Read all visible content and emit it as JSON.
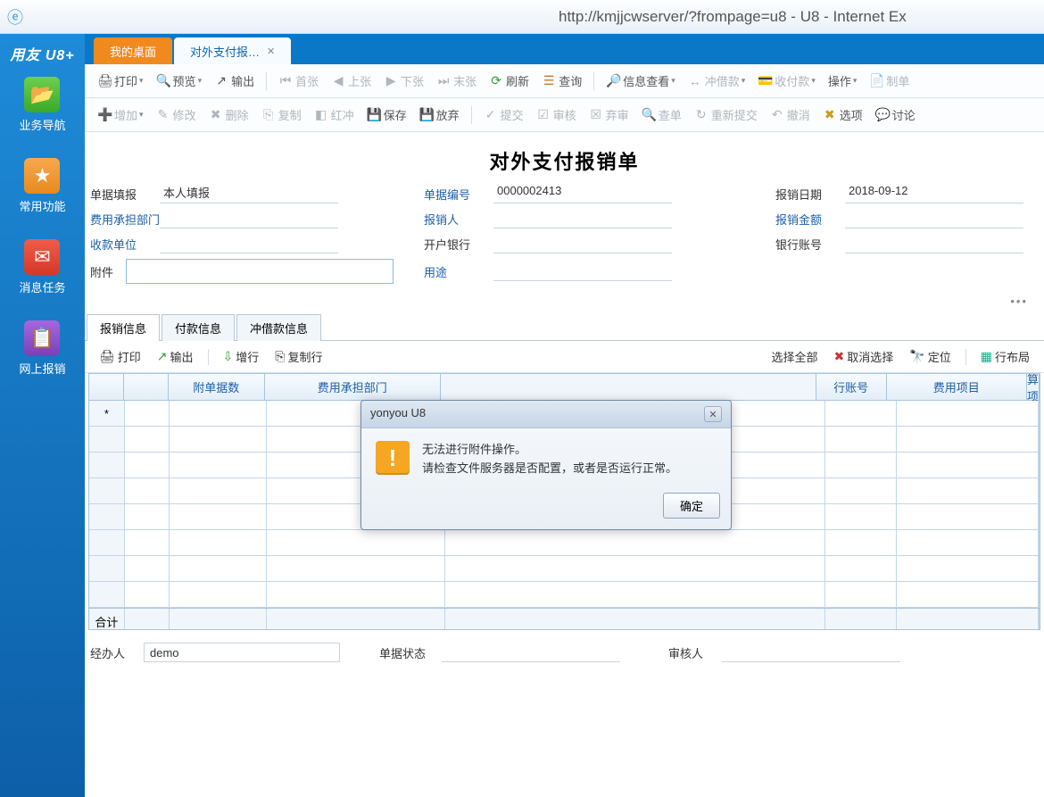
{
  "browser": {
    "title": "http://kmjjcwserver/?frompage=u8 - U8 - Internet Ex"
  },
  "brand": "用友 U8+",
  "sidebar": {
    "items": [
      {
        "label": "业务导航",
        "icon": "📂"
      },
      {
        "label": "常用功能",
        "icon": "★"
      },
      {
        "label": "消息任务",
        "icon": "✉"
      },
      {
        "label": "网上报销",
        "icon": "📋"
      }
    ]
  },
  "tabs": {
    "home": "我的桌面",
    "active": "对外支付报…"
  },
  "toolbar1": {
    "print": "打印",
    "preview": "预览",
    "export": "输出",
    "first": "首张",
    "prev": "上张",
    "next": "下张",
    "last": "末张",
    "refresh": "刷新",
    "query": "查询",
    "infoquery": "信息查看",
    "chongjiekuan": "冲借款",
    "shoufukuan": "收付款",
    "operate": "操作",
    "makebill": "制单"
  },
  "toolbar2": {
    "add": "增加",
    "edit": "修改",
    "delete": "删除",
    "copy": "复制",
    "hongchong": "红冲",
    "save": "保存",
    "abandon": "放弃",
    "submit": "提交",
    "audit": "审核",
    "unaudit": "弃审",
    "chadan": "查单",
    "resubmit": "重新提交",
    "cancelop": "撤消",
    "options": "选项",
    "discuss": "讨论"
  },
  "doc": {
    "title": "对外支付报销单",
    "fields": {
      "billfill_label": "单据填报",
      "billfill_value": "本人填报",
      "billno_label": "单据编号",
      "billno_value": "0000002413",
      "date_label": "报销日期",
      "date_value": "2018-09-12",
      "dept_label": "费用承担部门",
      "dept_value": "",
      "person_label": "报销人",
      "person_value": "",
      "amount_label": "报销金额",
      "amount_value": "",
      "payee_label": "收款单位",
      "payee_value": "",
      "bank_label": "开户银行",
      "bank_value": "",
      "account_label": "银行账号",
      "account_value": "",
      "attach_label": "附件",
      "attach_value": "",
      "usage_label": "用途",
      "usage_value": ""
    }
  },
  "subtabs": [
    "报销信息",
    "付款信息",
    "冲借款信息"
  ],
  "gridtoolbar": {
    "print": "打印",
    "export": "输出",
    "addrow": "增行",
    "copyrow": "复制行",
    "selectall": "选择全部",
    "unselect": "取消选择",
    "locate": "定位",
    "layout": "行布局"
  },
  "grid": {
    "columns": [
      "",
      "",
      "附单据数",
      "费用承担部门",
      "行账号",
      "费用项目",
      "预算项目"
    ],
    "widths": [
      40,
      50,
      110,
      200,
      170,
      190,
      160
    ],
    "row_marker": "*",
    "footer_label": "合计"
  },
  "bottom": {
    "handler_label": "经办人",
    "handler_value": "demo",
    "status_label": "单据状态",
    "status_value": "",
    "auditor_label": "审核人",
    "auditor_value": ""
  },
  "modal": {
    "title": "yonyou U8",
    "line1": "无法进行附件操作。",
    "line2": "请检查文件服务器是否配置，或者是否运行正常。",
    "ok": "确定"
  }
}
